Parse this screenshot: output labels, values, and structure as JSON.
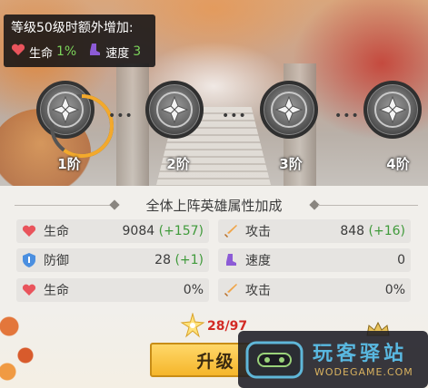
{
  "bonus_tooltip": {
    "title": "等级50级时额外增加:",
    "items": [
      {
        "icon": "heart-icon",
        "label": "生命",
        "value": "1%"
      },
      {
        "icon": "boot-icon",
        "label": "速度",
        "value": "3"
      }
    ]
  },
  "tiers": [
    {
      "label": "1阶",
      "progress": 0.6
    },
    {
      "label": "2阶"
    },
    {
      "label": "3阶"
    },
    {
      "label": "4阶"
    }
  ],
  "section_title": "全体上阵英雄属性加成",
  "stats": [
    {
      "icon": "heart-icon",
      "label": "生命",
      "value": "9084",
      "bonus": "(+157)"
    },
    {
      "icon": "sword-icon",
      "label": "攻击",
      "value": "848",
      "bonus": "(+16)"
    },
    {
      "icon": "shield-icon",
      "label": "防御",
      "value": "28",
      "bonus": "(+1)"
    },
    {
      "icon": "boot-icon",
      "label": "速度",
      "value": "0",
      "bonus": ""
    },
    {
      "icon": "heart-icon",
      "label": "生命",
      "value": "0%",
      "bonus": ""
    },
    {
      "icon": "sword-icon",
      "label": "攻击",
      "value": "0%",
      "bonus": ""
    }
  ],
  "material": {
    "icon": "star-crystal-icon",
    "count": "28/97"
  },
  "upgrade_button": {
    "label": "升级"
  },
  "watermark": {
    "brand": "玩客驿站",
    "url": "WODEGAME.COM"
  },
  "colors": {
    "accent_button": "#f5b62b",
    "bonus_green": "#3f9a3a",
    "count_red": "#d32a24",
    "progress_ring": "#f3a92c"
  }
}
